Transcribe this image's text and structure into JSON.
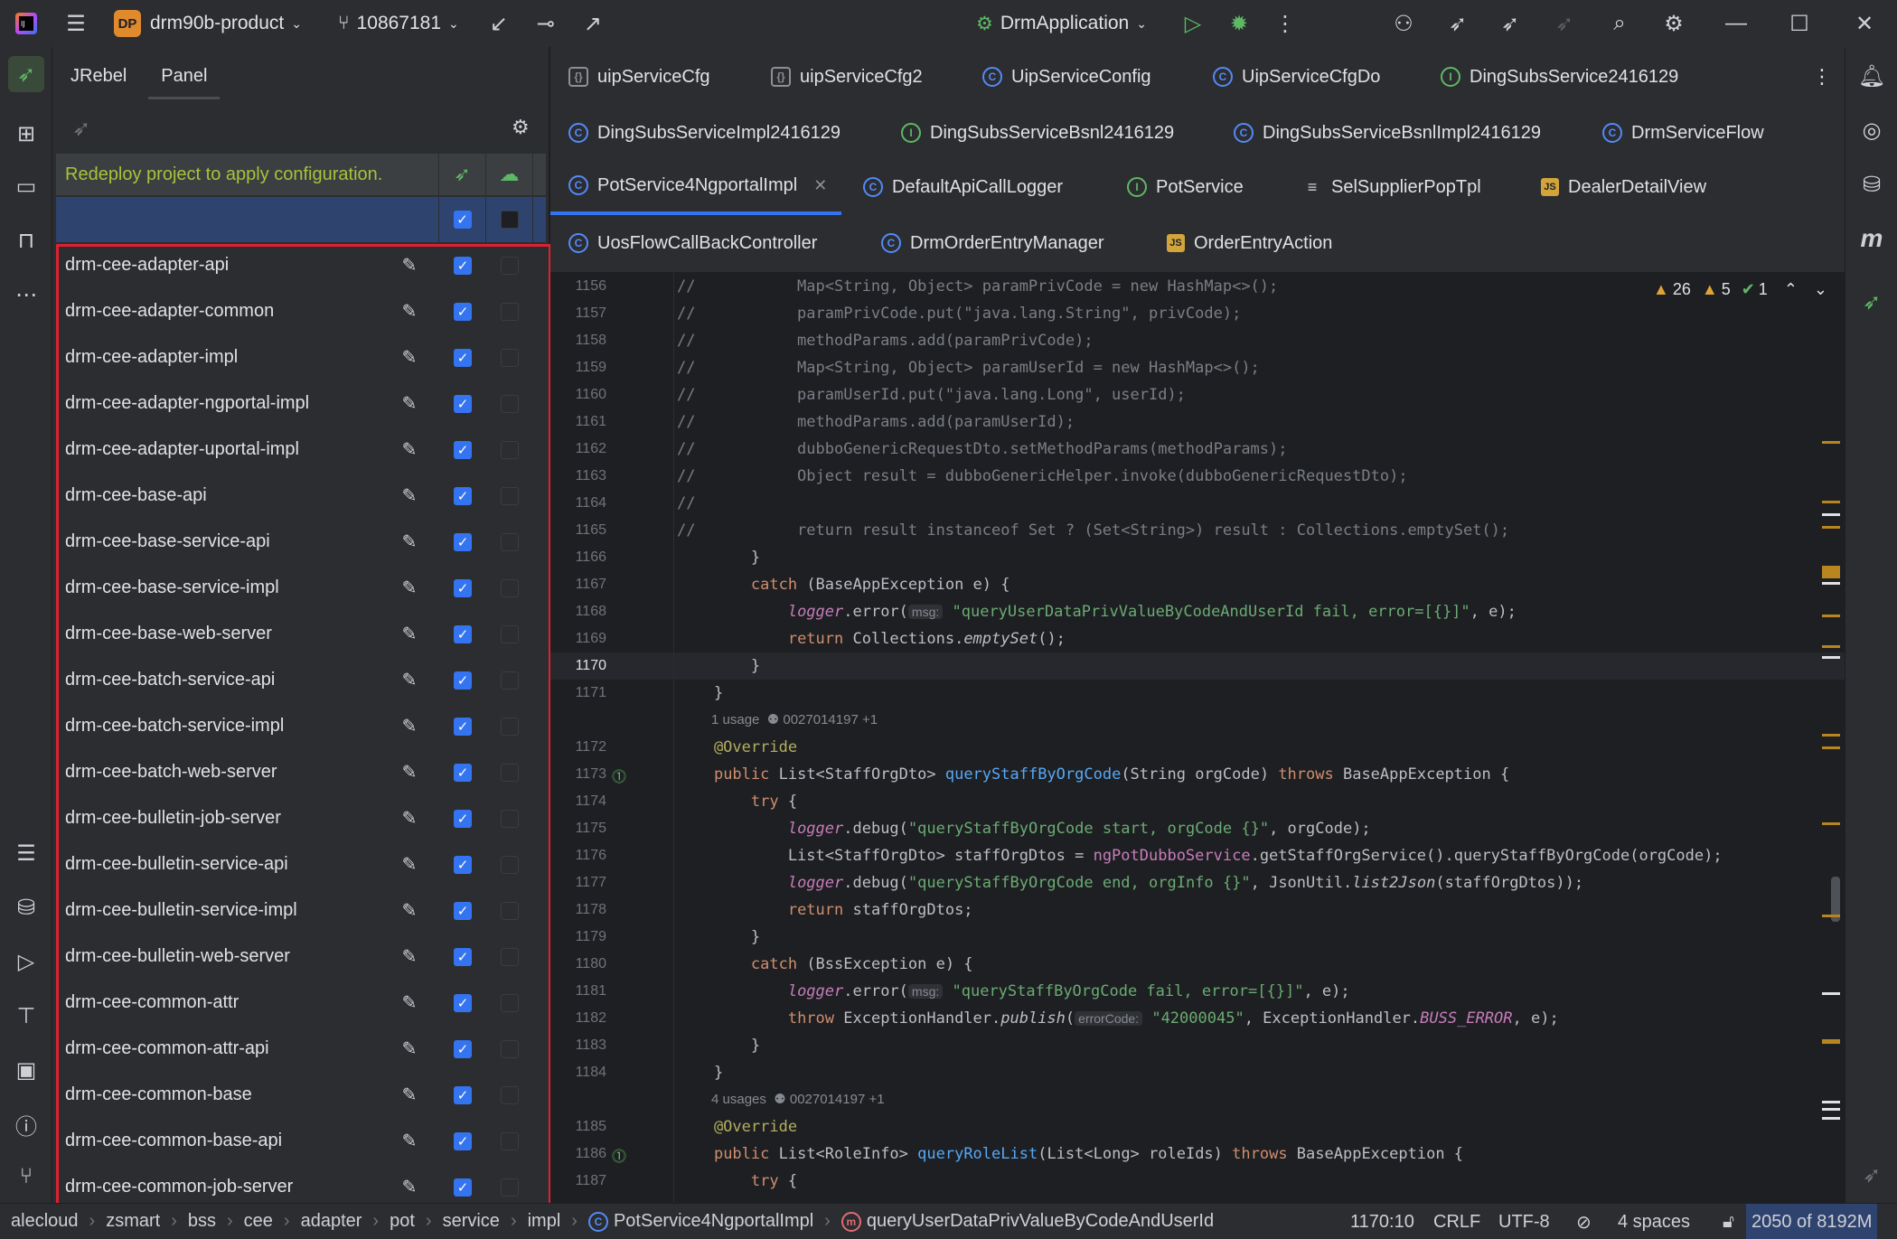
{
  "titlebar": {
    "project_badge": "DP",
    "project_name": "drm90b-product",
    "branch": "10867181",
    "run_config": "DrmApplication"
  },
  "jrebel": {
    "tabs": [
      "JRebel",
      "Panel"
    ],
    "header_message": "Redeploy project to apply configuration.",
    "modules": [
      "drm-cee-adapter-api",
      "drm-cee-adapter-common",
      "drm-cee-adapter-impl",
      "drm-cee-adapter-ngportal-impl",
      "drm-cee-adapter-uportal-impl",
      "drm-cee-base-api",
      "drm-cee-base-service-api",
      "drm-cee-base-service-impl",
      "drm-cee-base-web-server",
      "drm-cee-batch-service-api",
      "drm-cee-batch-service-impl",
      "drm-cee-batch-web-server",
      "drm-cee-bulletin-job-server",
      "drm-cee-bulletin-service-api",
      "drm-cee-bulletin-service-impl",
      "drm-cee-bulletin-web-server",
      "drm-cee-common-attr",
      "drm-cee-common-attr-api",
      "drm-cee-common-base",
      "drm-cee-common-base-api",
      "drm-cee-common-job-server"
    ]
  },
  "editor_tabs": {
    "row1": [
      "uipServiceCfg",
      "uipServiceCfg2",
      "UipServiceConfig",
      "UipServiceCfgDo",
      "DingSubsService2416129"
    ],
    "row2": [
      "DingSubsServiceImpl2416129",
      "DingSubsServiceBsnl2416129",
      "DingSubsServiceBsnlImpl2416129",
      "DrmServiceFlow"
    ],
    "row3": [
      "PotService4NgportalImpl",
      "DefaultApiCallLogger",
      "PotService",
      "SelSupplierPopTpl",
      "DealerDetailView"
    ],
    "row4": [
      "UosFlowCallBackController",
      "DrmOrderEntryManager",
      "OrderEntryAction"
    ]
  },
  "inspections": {
    "warnings": "26",
    "weak_warnings": "5",
    "ok": "1"
  },
  "line_numbers": [
    "1156",
    "1157",
    "1158",
    "1159",
    "1160",
    "1161",
    "1162",
    "1163",
    "1164",
    "1165",
    "1166",
    "1167",
    "1168",
    "1169",
    "1170",
    "1171",
    "1172",
    "1173",
    "1174",
    "1175",
    "1176",
    "1177",
    "1178",
    "1179",
    "1180",
    "1181",
    "1182",
    "1183",
    "1184",
    "1185",
    "1186",
    "1187"
  ],
  "usages": {
    "u1": "1 usage",
    "u1_author": "0027014197 +1",
    "u2": "4 usages",
    "u2_author": "0027014197 +1"
  },
  "statusbar": {
    "breadcrumbs": [
      "alecloud",
      "zsmart",
      "bss",
      "cee",
      "adapter",
      "pot",
      "service",
      "impl",
      "PotService4NgportalImpl",
      "queryUserDataPrivValueByCodeAndUserId"
    ],
    "position": "1170:10",
    "line_sep": "CRLF",
    "encoding": "UTF-8",
    "indent": "4 spaces",
    "memory": "2050 of 8192M"
  }
}
